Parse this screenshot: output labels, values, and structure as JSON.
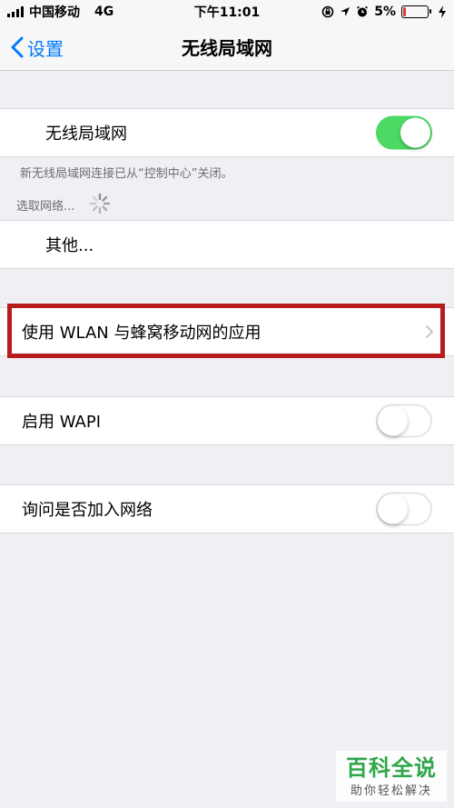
{
  "status_bar": {
    "carrier": "中国移动",
    "network": "4G",
    "time": "下午11:01",
    "battery": "5%",
    "icons": [
      "signal-icon",
      "orientation-lock-icon",
      "location-icon",
      "alarm-icon",
      "battery-icon",
      "charging-icon"
    ]
  },
  "nav": {
    "back_label": "设置",
    "title": "无线局域网"
  },
  "wifi_section": {
    "label": "无线局域网",
    "toggle_state": "on",
    "note": "新无线局域网连接已从“控制中心”关闭。"
  },
  "networks": {
    "choose_label": "选取网络...",
    "other_label": "其他..."
  },
  "apps_row": {
    "label": "使用 WLAN 与蜂窝移动网的应用"
  },
  "wapi_row": {
    "label": "启用 WAPI",
    "toggle_state": "off"
  },
  "ask_join_row": {
    "label": "询问是否加入网络",
    "toggle_state": "off"
  },
  "watermark": {
    "title": "百科全说",
    "subtitle": "助你轻松解决"
  },
  "colors": {
    "accent": "#007aff",
    "toggle_on": "#4cd964",
    "highlight": "#b71c1c",
    "watermark": "#2ea64a"
  }
}
